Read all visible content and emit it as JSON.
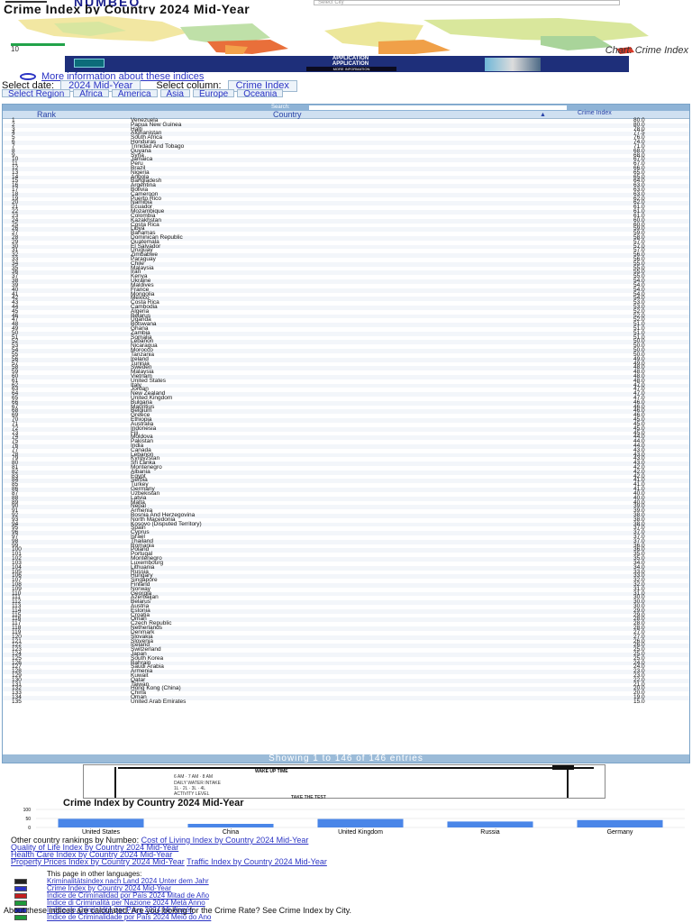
{
  "header": {
    "logo": "NUMBEO",
    "city_search_placeholder": "Select City",
    "page_title": "Crime Index by Country 2024 Mid-Year"
  },
  "map": {
    "legend_min": "10",
    "link_text": "Chart: Crime Index"
  },
  "ad": {
    "line1": "APPLICATION",
    "line2": "APPLICATION",
    "cta": "MORE INFORMATION"
  },
  "info_link": "More information about these indices",
  "controls": {
    "period_label": "Select date:",
    "period_value": "2024 Mid-Year",
    "index_label": "Select column:",
    "index_value": "Crime Index"
  },
  "regions": [
    {
      "label": "Select Region"
    },
    {
      "label": "Africa"
    },
    {
      "label": "America"
    },
    {
      "label": "Asia"
    },
    {
      "label": "Europe"
    },
    {
      "label": "Oceania"
    }
  ],
  "table": {
    "search_label": "Search:",
    "col_rank": "Rank",
    "col_country": "Country",
    "col_index": "Crime Index",
    "footer": "Showing 1 to 146 of 146 entries",
    "rows": [
      {
        "rank": "1",
        "country": "Venezuela",
        "index": "80.0"
      },
      {
        "rank": "2",
        "country": "Papua New Guinea",
        "index": "80.0"
      },
      {
        "rank": "3",
        "country": "Haiti",
        "index": "78.0"
      },
      {
        "rank": "4",
        "country": "Afghanistan",
        "index": "77.5"
      },
      {
        "rank": "5",
        "country": "South Africa",
        "index": "76.0"
      },
      {
        "rank": "6",
        "country": "Honduras",
        "index": "74.0"
      },
      {
        "rank": "7",
        "country": "Trinidad And Tobago",
        "index": "71.0"
      },
      {
        "rank": "8",
        "country": "Guyana",
        "index": "68.0"
      },
      {
        "rank": "9",
        "country": "Syria",
        "index": "68.0"
      },
      {
        "rank": "10",
        "country": "Jamaica",
        "index": "67.0"
      },
      {
        "rank": "11",
        "country": "Peru",
        "index": "67.0"
      },
      {
        "rank": "12",
        "country": "Brazil",
        "index": "66.0"
      },
      {
        "rank": "13",
        "country": "Nigeria",
        "index": "65.0"
      },
      {
        "rank": "14",
        "country": "Angola",
        "index": "65.0"
      },
      {
        "rank": "15",
        "country": "Bangladesh",
        "index": "64.0"
      },
      {
        "rank": "16",
        "country": "Argentina",
        "index": "63.0"
      },
      {
        "rank": "17",
        "country": "Bolivia",
        "index": "63.0"
      },
      {
        "rank": "18",
        "country": "Cameroon",
        "index": "63.0"
      },
      {
        "rank": "19",
        "country": "Puerto Rico",
        "index": "62.0"
      },
      {
        "rank": "20",
        "country": "Namibia",
        "index": "62.0"
      },
      {
        "rank": "21",
        "country": "Ecuador",
        "index": "61.0"
      },
      {
        "rank": "22",
        "country": "Mozambique",
        "index": "61.0"
      },
      {
        "rank": "23",
        "country": "Colombia",
        "index": "61.0"
      },
      {
        "rank": "24",
        "country": "Kazakhstan",
        "index": "60.0"
      },
      {
        "rank": "25",
        "country": "Costa Rica",
        "index": "60.0"
      },
      {
        "rank": "26",
        "country": "Libya",
        "index": "59.0"
      },
      {
        "rank": "27",
        "country": "Bahamas",
        "index": "59.0"
      },
      {
        "rank": "28",
        "country": "Dominican Republic",
        "index": "58.0"
      },
      {
        "rank": "29",
        "country": "Guatemala",
        "index": "57.0"
      },
      {
        "rank": "30",
        "country": "El Salvador",
        "index": "57.0"
      },
      {
        "rank": "31",
        "country": "Uruguay",
        "index": "57.0"
      },
      {
        "rank": "32",
        "country": "Zimbabwe",
        "index": "56.0"
      },
      {
        "rank": "33",
        "country": "Paraguay",
        "index": "56.0"
      },
      {
        "rank": "34",
        "country": "Chile",
        "index": "55.0"
      },
      {
        "rank": "35",
        "country": "Malaysia",
        "index": "55.0"
      },
      {
        "rank": "36",
        "country": "Iran",
        "index": "55.0"
      },
      {
        "rank": "37",
        "country": "Kenya",
        "index": "55.0"
      },
      {
        "rank": "38",
        "country": "Ukraine",
        "index": "54.0"
      },
      {
        "rank": "39",
        "country": "Maldives",
        "index": "54.0"
      },
      {
        "rank": "40",
        "country": "France",
        "index": "54.0"
      },
      {
        "rank": "41",
        "country": "Mongolia",
        "index": "54.0"
      },
      {
        "rank": "42",
        "country": "Mexico",
        "index": "54.0"
      },
      {
        "rank": "43",
        "country": "Costa Rica",
        "index": "53.0"
      },
      {
        "rank": "44",
        "country": "Cambodia",
        "index": "53.0"
      },
      {
        "rank": "45",
        "country": "Algeria",
        "index": "52.0"
      },
      {
        "rank": "46",
        "country": "Belarus",
        "index": "52.0"
      },
      {
        "rank": "47",
        "country": "Uganda",
        "index": "52.0"
      },
      {
        "rank": "48",
        "country": "Botswana",
        "index": "51.0"
      },
      {
        "rank": "49",
        "country": "Ghana",
        "index": "51.0"
      },
      {
        "rank": "50",
        "country": "Zambia",
        "index": "51.0"
      },
      {
        "rank": "51",
        "country": "Somalia",
        "index": "51.0"
      },
      {
        "rank": "52",
        "country": "Lebanon",
        "index": "50.0"
      },
      {
        "rank": "53",
        "country": "Nicaragua",
        "index": "50.0"
      },
      {
        "rank": "54",
        "country": "Morocco",
        "index": "50.0"
      },
      {
        "rank": "55",
        "country": "Tanzania",
        "index": "50.0"
      },
      {
        "rank": "56",
        "country": "Ireland",
        "index": "49.0"
      },
      {
        "rank": "57",
        "country": "Tunisia",
        "index": "49.0"
      },
      {
        "rank": "58",
        "country": "Sweden",
        "index": "48.0"
      },
      {
        "rank": "59",
        "country": "Malaysia",
        "index": "48.0"
      },
      {
        "rank": "60",
        "country": "Vietnam",
        "index": "48.0"
      },
      {
        "rank": "61",
        "country": "United States",
        "index": "48.0"
      },
      {
        "rank": "62",
        "country": "Italy",
        "index": "47.0"
      },
      {
        "rank": "63",
        "country": "Jordan",
        "index": "47.0"
      },
      {
        "rank": "64",
        "country": "New Zealand",
        "index": "47.0"
      },
      {
        "rank": "65",
        "country": "United Kingdom",
        "index": "47.0"
      },
      {
        "rank": "66",
        "country": "Bulgaria",
        "index": "46.0"
      },
      {
        "rank": "67",
        "country": "Mauritius",
        "index": "46.0"
      },
      {
        "rank": "68",
        "country": "Belgium",
        "index": "46.0"
      },
      {
        "rank": "69",
        "country": "Greece",
        "index": "46.0"
      },
      {
        "rank": "70",
        "country": "Ethiopia",
        "index": "45.0"
      },
      {
        "rank": "71",
        "country": "Australia",
        "index": "45.0"
      },
      {
        "rank": "72",
        "country": "Indonesia",
        "index": "45.0"
      },
      {
        "rank": "73",
        "country": "Fiji",
        "index": "45.0"
      },
      {
        "rank": "74",
        "country": "Moldova",
        "index": "44.0"
      },
      {
        "rank": "75",
        "country": "Pakistan",
        "index": "44.0"
      },
      {
        "rank": "76",
        "country": "India",
        "index": "44.0"
      },
      {
        "rank": "77",
        "country": "Canada",
        "index": "43.0"
      },
      {
        "rank": "78",
        "country": "Lebanon",
        "index": "43.0"
      },
      {
        "rank": "79",
        "country": "Kyrgyzstan",
        "index": "43.0"
      },
      {
        "rank": "80",
        "country": "Sri Lanka",
        "index": "43.0"
      },
      {
        "rank": "81",
        "country": "Montenegro",
        "index": "42.0"
      },
      {
        "rank": "82",
        "country": "Albania",
        "index": "42.0"
      },
      {
        "rank": "83",
        "country": "Egypt",
        "index": "42.0"
      },
      {
        "rank": "84",
        "country": "Serbia",
        "index": "41.0"
      },
      {
        "rank": "85",
        "country": "Turkey",
        "index": "41.0"
      },
      {
        "rank": "86",
        "country": "Germany",
        "index": "41.0"
      },
      {
        "rank": "87",
        "country": "Uzbekistan",
        "index": "40.0"
      },
      {
        "rank": "88",
        "country": "Latvia",
        "index": "40.0"
      },
      {
        "rank": "89",
        "country": "Malta",
        "index": "40.0"
      },
      {
        "rank": "90",
        "country": "Nepal",
        "index": "39.0"
      },
      {
        "rank": "91",
        "country": "Armenia",
        "index": "39.0"
      },
      {
        "rank": "92",
        "country": "Bosnia And Herzegovina",
        "index": "38.0"
      },
      {
        "rank": "93",
        "country": "North Macedonia",
        "index": "38.0"
      },
      {
        "rank": "94",
        "country": "Kosovo (Disputed Territory)",
        "index": "38.0"
      },
      {
        "rank": "95",
        "country": "Spain",
        "index": "37.0"
      },
      {
        "rank": "96",
        "country": "Cyprus",
        "index": "37.0"
      },
      {
        "rank": "97",
        "country": "Israel",
        "index": "37.0"
      },
      {
        "rank": "98",
        "country": "Thailand",
        "index": "37.0"
      },
      {
        "rank": "99",
        "country": "Romania",
        "index": "36.0"
      },
      {
        "rank": "100",
        "country": "Poland",
        "index": "36.0"
      },
      {
        "rank": "101",
        "country": "Portugal",
        "index": "35.0"
      },
      {
        "rank": "102",
        "country": "Montenegro",
        "index": "35.0"
      },
      {
        "rank": "103",
        "country": "Luxembourg",
        "index": "34.0"
      },
      {
        "rank": "104",
        "country": "Lithuania",
        "index": "34.0"
      },
      {
        "rank": "105",
        "country": "Russia",
        "index": "33.0"
      },
      {
        "rank": "106",
        "country": "Hungary",
        "index": "33.0"
      },
      {
        "rank": "107",
        "country": "Singapore",
        "index": "32.0"
      },
      {
        "rank": "108",
        "country": "Finland",
        "index": "32.0"
      },
      {
        "rank": "109",
        "country": "Norway",
        "index": "31.0"
      },
      {
        "rank": "110",
        "country": "Georgia",
        "index": "31.0"
      },
      {
        "rank": "111",
        "country": "Azerbaijan",
        "index": "30.0"
      },
      {
        "rank": "112",
        "country": "Belarus",
        "index": "30.0"
      },
      {
        "rank": "113",
        "country": "Austria",
        "index": "30.0"
      },
      {
        "rank": "114",
        "country": "Estonia",
        "index": "29.0"
      },
      {
        "rank": "115",
        "country": "Croatia",
        "index": "29.0"
      },
      {
        "rank": "116",
        "country": "Oman",
        "index": "28.0"
      },
      {
        "rank": "117",
        "country": "Czech Republic",
        "index": "28.0"
      },
      {
        "rank": "118",
        "country": "Netherlands",
        "index": "28.0"
      },
      {
        "rank": "119",
        "country": "Denmark",
        "index": "27.0"
      },
      {
        "rank": "120",
        "country": "Slovakia",
        "index": "27.0"
      },
      {
        "rank": "121",
        "country": "Slovenia",
        "index": "26.0"
      },
      {
        "rank": "122",
        "country": "Iceland",
        "index": "26.0"
      },
      {
        "rank": "123",
        "country": "Switzerland",
        "index": "25.0"
      },
      {
        "rank": "124",
        "country": "Japan",
        "index": "25.0"
      },
      {
        "rank": "125",
        "country": "South Korea",
        "index": "25.0"
      },
      {
        "rank": "126",
        "country": "Bahrain",
        "index": "24.0"
      },
      {
        "rank": "127",
        "country": "Saudi Arabia",
        "index": "24.0"
      },
      {
        "rank": "128",
        "country": "Armenia",
        "index": "23.0"
      },
      {
        "rank": "129",
        "country": "Kuwait",
        "index": "23.0"
      },
      {
        "rank": "130",
        "country": "Qatar",
        "index": "22.0"
      },
      {
        "rank": "131",
        "country": "Taiwan",
        "index": "21.0"
      },
      {
        "rank": "132",
        "country": "Hong Kong (China)",
        "index": "20.0"
      },
      {
        "rank": "133",
        "country": "China",
        "index": "20.0"
      },
      {
        "rank": "134",
        "country": "Oman",
        "index": "19.0"
      },
      {
        "rank": "135",
        "country": "United Arab Emirates",
        "index": "15.0"
      }
    ]
  },
  "flyer": {
    "title": "WAKE UP TIME",
    "r1": "6 AM · 7 AM · 8 AM",
    "r2": "DAILY WATER INTAKE",
    "r3": "1L · 2L · 3L · 4L",
    "r4": "ACTIVITY LEVEL",
    "cta": "TAKE THE TEST"
  },
  "chart_data": {
    "type": "bar",
    "title": "Crime Index by Country 2024 Mid-Year",
    "categories": [
      "United States",
      "China",
      "United Kingdom",
      "Russia",
      "Germany"
    ],
    "values": [
      48.0,
      20.0,
      47.0,
      33.0,
      41.0
    ],
    "ylim": [
      0,
      100
    ],
    "yticks": [
      "100",
      "50",
      "0"
    ],
    "bar_color": "#4a86e8",
    "grid": true,
    "legend": "none"
  },
  "related": {
    "label": "Other country rankings by Numbeo:",
    "links": [
      "Cost of Living Index by Country 2024 Mid-Year",
      "Quality of Life Index by Country 2024 Mid-Year",
      "Health Care Index by Country 2024 Mid-Year",
      "Property Prices Index by Country 2024 Mid-Year",
      "Traffic Index by Country 2024 Mid-Year"
    ]
  },
  "languages": {
    "label": "This page in other languages:",
    "items": [
      {
        "text": "Kriminalitätsindex nach Land 2024 Unter dem Jahr",
        "flag_color": "#222222"
      },
      {
        "text": "Crime Index by Country 2024 Mid-Year",
        "flag_color": "#2a33c4"
      },
      {
        "text": "Índice de Criminalidad por País 2024 Mitad de Año",
        "flag_color": "#c41e1e"
      },
      {
        "text": "Indice di Criminalità per Nazione 2024 Metà Anno",
        "flag_color": "#1e9a3a"
      },
      {
        "text": "Indice de Criminalité par Pays 2024 Mi-Année",
        "flag_color": "#2a33c4"
      },
      {
        "text": "Índice de Criminalidade por País 2024 Meio do Ano",
        "flag_color": "#1e9a3a"
      }
    ]
  },
  "about": {
    "text": "About these indices are calculated. Are you looking for the Crime Rate? See Crime Index by City."
  }
}
